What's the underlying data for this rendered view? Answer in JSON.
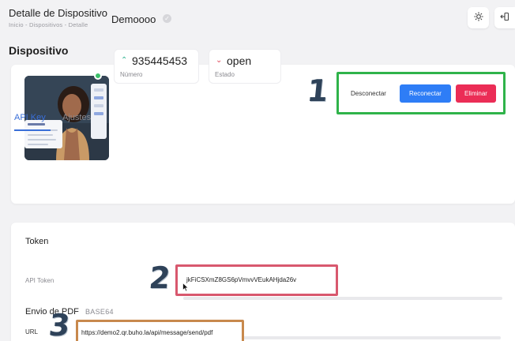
{
  "header": {
    "title": "Detalle de Dispositivo",
    "breadcrumb": "Inicio - Dispositivos - Detalle",
    "theme_icon": "sun-icon",
    "logout_icon": "logout-icon"
  },
  "page": {
    "section_title": "Dispositivo"
  },
  "device": {
    "name": "Demoooo",
    "verified_icon": "check-badge-icon",
    "status_dot_color": "#3cc06a",
    "number": {
      "value": "935445453",
      "label": "Número",
      "arrow_icon": "arrow-up-icon",
      "arrow_color": "#2fb390"
    },
    "state": {
      "value": "open",
      "label": "Estado",
      "arrow_icon": "arrow-down-icon",
      "arrow_color": "#e04a5c"
    }
  },
  "actions": {
    "disconnect_label": "Desconectar",
    "reconnect_label": "Reconectar",
    "delete_label": "Eliminar",
    "reconnect_color": "#2e7df6",
    "delete_color": "#eb2d56"
  },
  "tabs": [
    {
      "label": "API Key",
      "active": true
    },
    {
      "label": "Ajustes",
      "active": false
    }
  ],
  "token_section": {
    "title": "Token",
    "api_token_label": "API Token",
    "api_token_value": "jkFiCSXmZ8GS6pVmvvVEukAHjda26v"
  },
  "pdf_section": {
    "title": "Envio de PDF",
    "subtitle": "BASE64",
    "url_label": "URL",
    "url_value": "https://demo2.qr.buho.la/api/message/send/pdf"
  },
  "annotations": {
    "one": "1",
    "two": "2",
    "three": "3",
    "box1_color": "#2fb34a",
    "box2_color": "#d8586e",
    "box3_color": "#c8894d"
  }
}
